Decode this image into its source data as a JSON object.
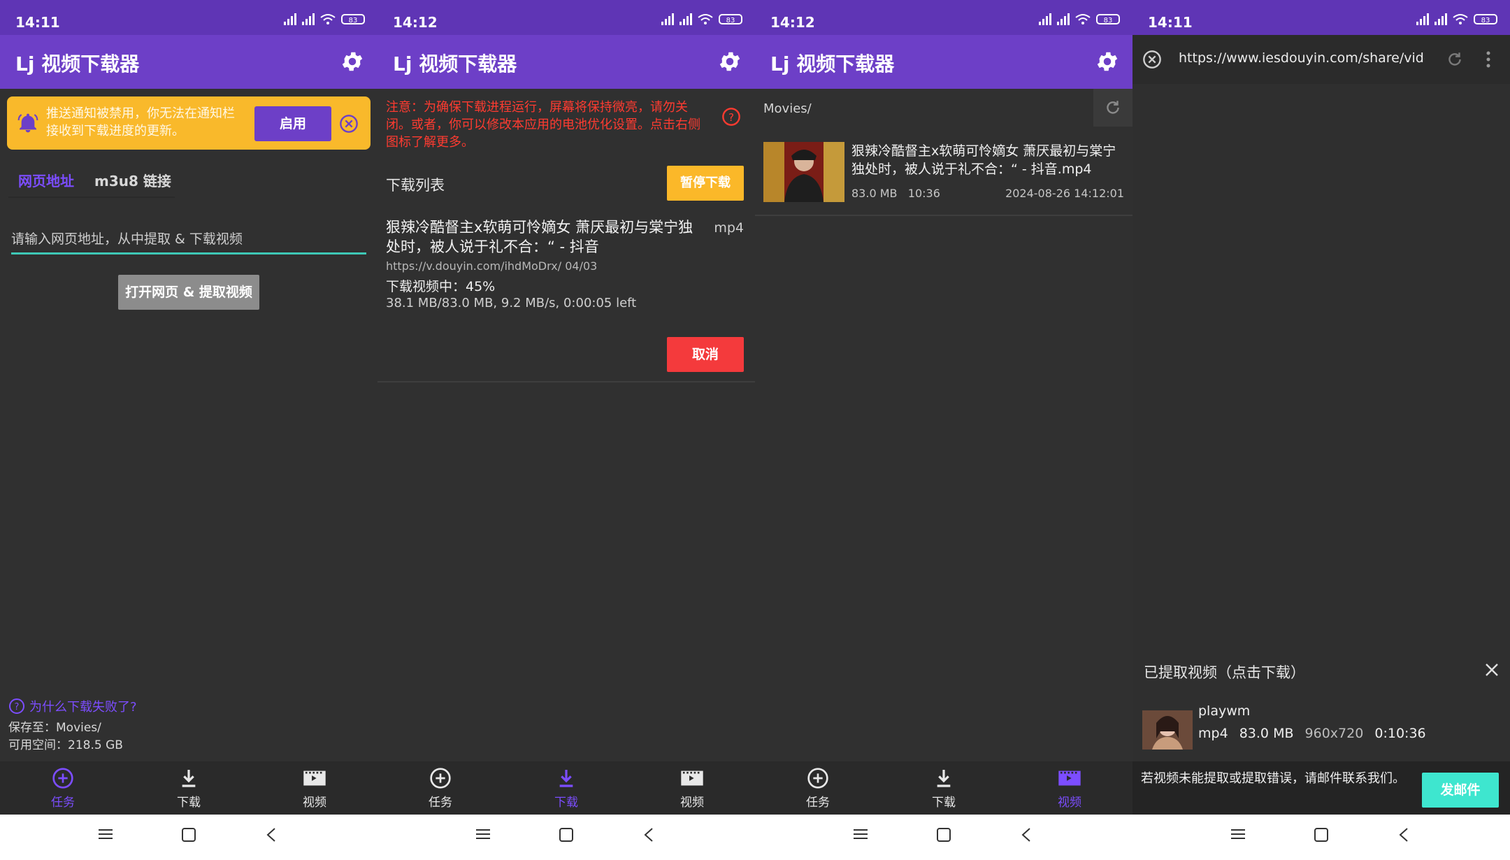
{
  "colors": {
    "primary": "#6d3fc7",
    "status_bar": "#5f35b5",
    "accent": "#7c4dff",
    "warning_banner": "#f9b92b",
    "pause_button": "#fbb829",
    "cancel_button": "#f43a3c",
    "mail_button": "#3ee6cf",
    "input_underline": "#3ec8b6",
    "error_text": "#ff3b30"
  },
  "screens": [
    {
      "time": "14:11",
      "battery": "83"
    },
    {
      "time": "14:12",
      "battery": "83"
    },
    {
      "time": "14:12",
      "battery": "83"
    },
    {
      "time": "14:11",
      "battery": "83"
    }
  ],
  "app": {
    "title": "Lj 视频下载器"
  },
  "nav": {
    "tasks": "任务",
    "downloads": "下载",
    "videos": "视频"
  },
  "tasks_screen": {
    "banner_text": "推送通知被禁用，你无法在通知栏接收到下载进度的更新。",
    "enable_button": "启用",
    "tab_webpage": "网页地址",
    "tab_m3u8": "m3u8 链接",
    "url_placeholder": "请输入网页地址，从中提取 & 下载视频",
    "open_button": "打开网页 & 提取视频",
    "help_link": "为什么下载失败了?",
    "save_to": "保存至：Movies/",
    "free_space": "可用空间：218.5 GB"
  },
  "downloads_screen": {
    "warning": "注意：为确保下载进程运行，屏幕将保持微亮，请勿关闭。或者，你可以修改本应用的电池优化设置。点击右侧图标了解更多。",
    "list_header": "下载列表",
    "pause_button": "暂停下载",
    "item": {
      "title": "狠辣冷酷督主x软萌可怜嫡女 萧厌最初与棠宁独处时，被人说于礼不合：“ - 抖音",
      "ext": "mp4",
      "url": "https://v.douyin.com/ihdMoDrx/ 04/03",
      "status": "下载视频中：45%",
      "progress": "38.1 MB/83.0 MB, 9.2 MB/s, 0:00:05 left",
      "progress_percent": 45
    },
    "cancel_button": "取消"
  },
  "videos_screen": {
    "path": "Movies/",
    "item": {
      "title": "狠辣冷酷督主x软萌可怜嫡女 萧厌最初与棠宁独处时，被人说于礼不合：“ - 抖音.mp4",
      "size": "83.0 MB",
      "duration": "10:36",
      "date": "2024-08-26 14:12:01"
    }
  },
  "browser_screen": {
    "url": "https://www.iesdouyin.com/share/video/",
    "sheet_title": "已提取视频（点击下载）",
    "video": {
      "name": "playwm",
      "format": "mp4",
      "size": "83.0 MB",
      "resolution": "960x720",
      "duration": "0:10:36"
    },
    "footer_text": "若视频未能提取或提取错误，请邮件联系我们。",
    "mail_button": "发邮件"
  }
}
